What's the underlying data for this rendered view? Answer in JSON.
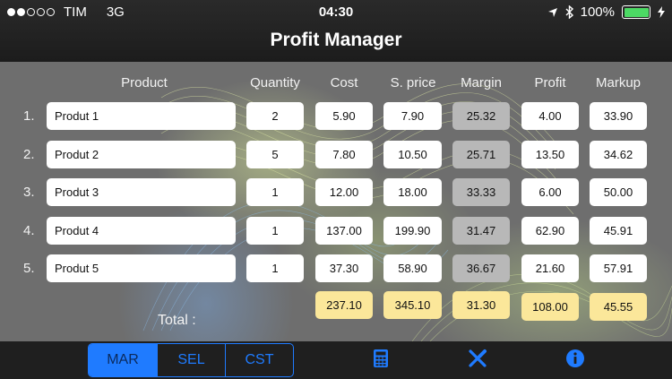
{
  "status_bar": {
    "carrier": "TIM",
    "network": "3G",
    "time": "04:30",
    "battery": "100%",
    "signal_bars": 2
  },
  "nav": {
    "title": "Profit Manager"
  },
  "table": {
    "headers": [
      "Product",
      "Quantity",
      "Cost",
      "S. price",
      "Margin",
      "Profit",
      "Markup"
    ],
    "rows": [
      {
        "num": "1.",
        "product": "Produt 1",
        "quantity": "2",
        "cost": "5.90",
        "sprice": "7.90",
        "margin": "25.32",
        "profit": "4.00",
        "markup": "33.90"
      },
      {
        "num": "2.",
        "product": "Produt 2",
        "quantity": "5",
        "cost": "7.80",
        "sprice": "10.50",
        "margin": "25.71",
        "profit": "13.50",
        "markup": "34.62"
      },
      {
        "num": "3.",
        "product": "Produt 3",
        "quantity": "1",
        "cost": "12.00",
        "sprice": "18.00",
        "margin": "33.33",
        "profit": "6.00",
        "markup": "50.00"
      },
      {
        "num": "4.",
        "product": "Produt 4",
        "quantity": "1",
        "cost": "137.00",
        "sprice": "199.90",
        "margin": "31.47",
        "profit": "62.90",
        "markup": "45.91"
      },
      {
        "num": "5.",
        "product": "Produt 5",
        "quantity": "1",
        "cost": "37.30",
        "sprice": "58.90",
        "margin": "36.67",
        "profit": "21.60",
        "markup": "57.91"
      }
    ],
    "total_label": "Total :",
    "totals": {
      "cost": "237.10",
      "sprice": "345.10",
      "margin": "31.30",
      "profit": "108.00",
      "markup": "45.55"
    }
  },
  "toolbar": {
    "segments": [
      "MAR",
      "SEL",
      "CST"
    ],
    "selected_segment": "MAR",
    "icons": [
      "calculator-icon",
      "clear-icon",
      "info-icon"
    ],
    "accent_color": "#1f7bff"
  }
}
